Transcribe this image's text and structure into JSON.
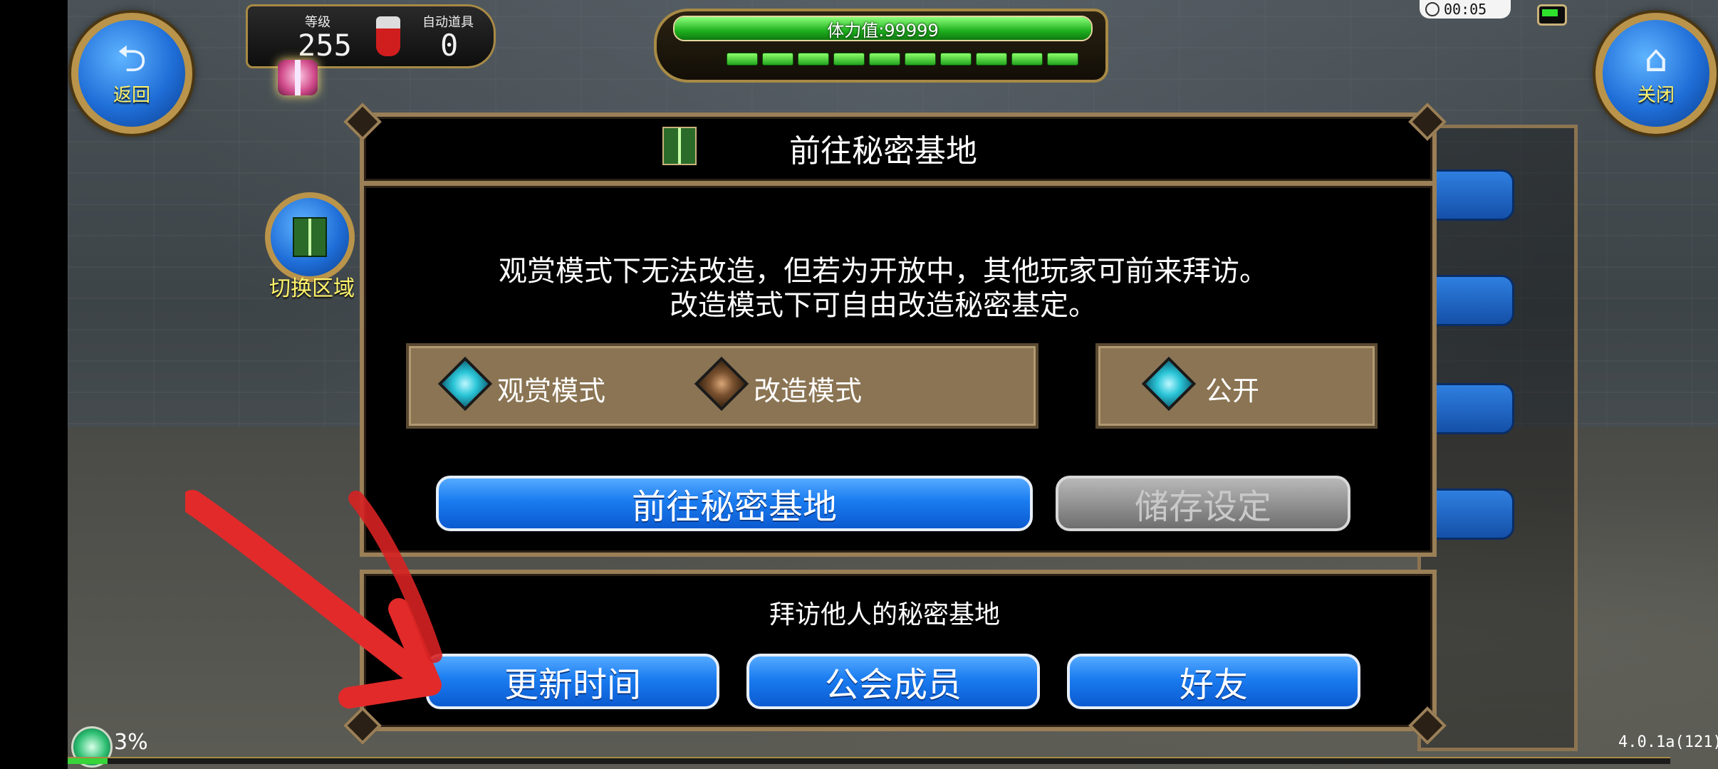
{
  "hud": {
    "back_label": "返回",
    "close_label": "关闭",
    "level_caption": "等级",
    "level_value": "255",
    "auto_item_caption": "自动道具",
    "auto_item_value": "0",
    "stamina_text": "体力值:99999",
    "stamina_fraction": 1.0,
    "stamina_pips": 10,
    "clock": "00:05",
    "area_switch_label": "切换区域",
    "network_percent": "3%",
    "loading_fraction": 0.025,
    "version": "4.0.1a(121)"
  },
  "dialog": {
    "title": "前往秘密基地",
    "description_line1": "观赏模式下无法改造，但若为开放中，其他玩家可前来拜访。",
    "description_line2": "改造模式下可自由改造秘密基定。",
    "modes": [
      {
        "label": "观赏模式",
        "selected": true
      },
      {
        "label": "改造模式",
        "selected": false
      }
    ],
    "public_label": "公开",
    "go_button": "前往秘密基地",
    "save_button": "储存设定"
  },
  "visit": {
    "title": "拜访他人的秘密基地",
    "buttons": [
      "更新时间",
      "公会成员",
      "好友"
    ]
  },
  "colors": {
    "button_blue": "#1a7cf0",
    "frame_gold": "#9a7f57",
    "arrow_red": "#e22a2a",
    "stamina_green": "#1fb11f"
  }
}
